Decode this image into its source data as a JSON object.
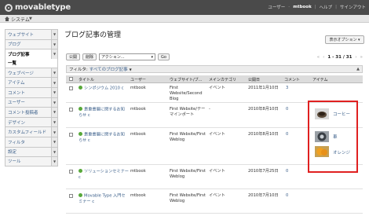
{
  "header": {
    "logo_text": "movabletype",
    "user_label": "ユーザー",
    "username": "mtbook",
    "help": "ヘルプ",
    "signout": "サインアウト"
  },
  "sysbar": {
    "label": "システム"
  },
  "sidebar": {
    "items": [
      {
        "label": "ウェブサイト"
      },
      {
        "label": "ブログ"
      },
      {
        "label": "ブログ記事"
      },
      {
        "label": "ウェブページ"
      },
      {
        "label": "アイテム"
      },
      {
        "label": "コメント"
      },
      {
        "label": "ユーザー"
      },
      {
        "label": "コメント投稿者"
      },
      {
        "label": "デザイン"
      },
      {
        "label": "カスタムフィールド"
      },
      {
        "label": "フィルタ"
      },
      {
        "label": "設定"
      },
      {
        "label": "ツール"
      }
    ],
    "submenu": "一覧"
  },
  "page": {
    "title": "ブログ記事の管理",
    "display_options": "表示オプション"
  },
  "actions": {
    "publish": "公開",
    "delete": "削除",
    "select_placeholder": "アクション...",
    "go": "Go"
  },
  "pager": {
    "first": "«",
    "prev": "‹",
    "range": "1 - 31 / 31",
    "next": "›",
    "last": "»"
  },
  "filter": {
    "label": "フィルタ:",
    "value": "すべてのブログ記事"
  },
  "table": {
    "columns": [
      "タイトル",
      "ユーザー",
      "ウェブサイト/ブ...",
      "メインカテゴリ",
      "公開日",
      "コメント",
      "アイテム"
    ],
    "rows": [
      {
        "title": "シンポジウム 2010 c",
        "user": "mtbook",
        "site": "First Website/Second Blog",
        "category": "イベント",
        "date": "2011年1月10日",
        "comments": "3",
        "items": []
      },
      {
        "title": "貴重書展に関するお知らせ c",
        "user": "mtbook",
        "site": "First Website/テーマインポート",
        "category": "-",
        "date": "2010年8月10日",
        "comments": "0",
        "items": [
          "コーヒー"
        ]
      },
      {
        "title": "貴重書展に関するお知らせ c",
        "user": "mtbook",
        "site": "First Website/First Weblog",
        "category": "イベント",
        "date": "2010年8月10日",
        "comments": "0",
        "items": [
          "車",
          "オレンジ"
        ]
      },
      {
        "title": "ソリューションセミナー c",
        "user": "mtbook",
        "site": "First Website/First Weblog",
        "category": "イベント",
        "date": "2010年7月25日",
        "comments": "0",
        "items": []
      },
      {
        "title": "Movable Type 入門セミナー c",
        "user": "mtbook",
        "site": "First Website/First Weblog",
        "category": "イベント",
        "date": "2010年7月10日",
        "comments": "0",
        "items": []
      }
    ]
  }
}
